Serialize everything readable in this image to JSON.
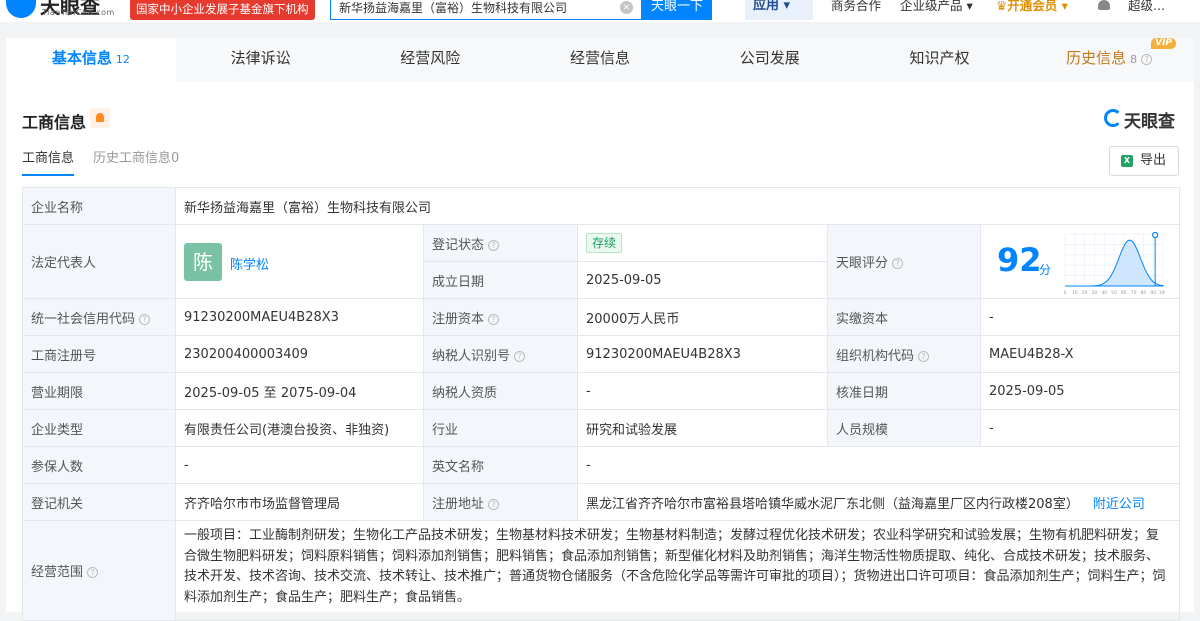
{
  "topbar": {
    "brand": "天眼查",
    "domain": "TianYanCha.com",
    "fund_badge": "国家中小企业发展子基金旗下机构",
    "search_query": "新华扬益海嘉里（富裕）生物科技有限公司",
    "search_button": "天眼一下",
    "app_button": "应用",
    "links": [
      "商务合作",
      "企业级产品"
    ],
    "vip_button": "开通会员",
    "user": "超级..."
  },
  "tabs": [
    {
      "label": "基本信息",
      "count": "12"
    },
    {
      "label": "法律诉讼"
    },
    {
      "label": "经营风险"
    },
    {
      "label": "经营信息"
    },
    {
      "label": "公司发展"
    },
    {
      "label": "知识产权"
    },
    {
      "label": "历史信息",
      "count": "8",
      "badge": "VIP"
    }
  ],
  "section": {
    "title": "工商信息",
    "logo_text": "天眼查",
    "subtabs": [
      "工商信息",
      "历史工商信息0"
    ],
    "export_label": "导出"
  },
  "info": {
    "company_name_label": "企业名称",
    "company_name": "新华扬益海嘉里（富裕）生物科技有限公司",
    "legal_rep_label": "法定代表人",
    "legal_rep_avatar": "陈",
    "legal_rep_name": "陈学松",
    "reg_status_label": "登记状态",
    "reg_status": "存续",
    "found_date_label": "成立日期",
    "found_date": "2025-09-05",
    "score_label": "天眼评分",
    "score": "92",
    "score_unit": "分",
    "credit_code_label": "统一社会信用代码",
    "credit_code": "91230200MAEU4B28X3",
    "reg_capital_label": "注册资本",
    "reg_capital": "20000万人民币",
    "paid_capital_label": "实缴资本",
    "paid_capital": "-",
    "reg_no_label": "工商注册号",
    "reg_no": "230200400003409",
    "taxpayer_id_label": "纳税人识别号",
    "taxpayer_id": "91230200MAEU4B28X3",
    "org_code_label": "组织机构代码",
    "org_code": "MAEU4B28-X",
    "term_label": "营业期限",
    "term": "2025-09-05 至 2075-09-04",
    "tax_qual_label": "纳税人资质",
    "tax_qual": "-",
    "approve_date_label": "核准日期",
    "approve_date": "2025-09-05",
    "type_label": "企业类型",
    "type": "有限责任公司(港澳台投资、非独资)",
    "industry_label": "行业",
    "industry": "研究和试验发展",
    "staff_label": "人员规模",
    "staff": "-",
    "insured_label": "参保人数",
    "insured": "-",
    "en_name_label": "英文名称",
    "en_name": "-",
    "authority_label": "登记机关",
    "authority": "齐齐哈尔市市场监督管理局",
    "address_label": "注册地址",
    "address": "黑龙江省齐齐哈尔市富裕县塔哈镇华威水泥厂东北侧（益海嘉里厂区内行政楼208室）",
    "nearby_link": "附近公司",
    "scope_label": "经营范围",
    "scope": "一般项目：工业酶制剂研发；生物化工产品技术研发；生物基材料技术研发；生物基材料制造；发酵过程优化技术研发；农业科学研究和试验发展；生物有机肥料研发；复合微生物肥料研发；饲料原料销售；饲料添加剂销售；肥料销售；食品添加剂销售；新型催化材料及助剂销售；海洋生物活性物质提取、纯化、合成技术研发；技术服务、技术开发、技术咨询、技术交流、技术转让、技术推广；普通货物仓储服务（不含危险化学品等需许可审批的项目）；货物进出口许可项目：食品添加剂生产；饲料生产；饲料添加剂生产；食品生产；肥料生产；食品销售。"
  },
  "score_chart": {
    "type": "area",
    "x": [
      0,
      10,
      20,
      30,
      40,
      50,
      60,
      70,
      80,
      90,
      100
    ],
    "marker": 92
  },
  "colors": {
    "accent": "#0084ff",
    "label_bg": "#f3f6fb",
    "status_green": "#1aa160",
    "vip_gold": "#e08f00"
  }
}
